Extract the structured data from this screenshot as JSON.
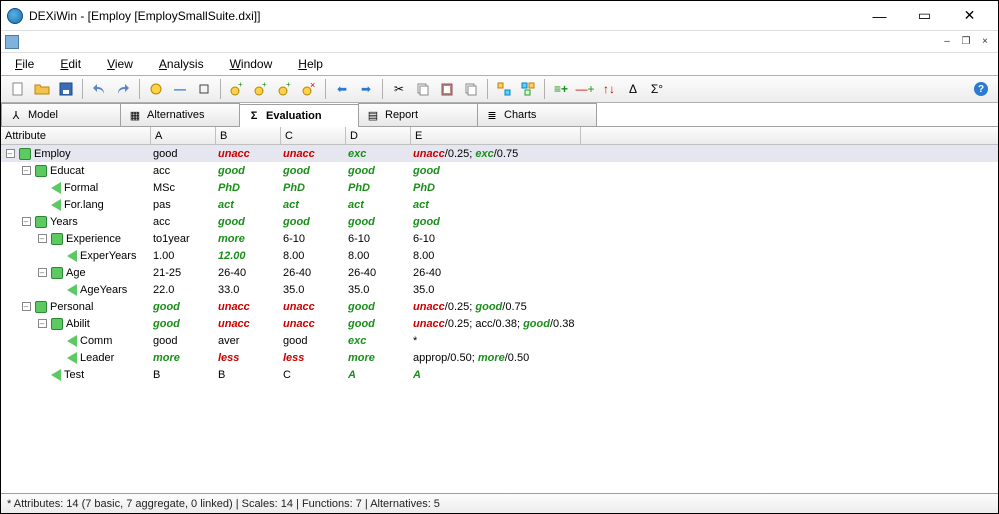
{
  "window": {
    "title": "DEXiWin - [Employ [EmploySmallSuite.dxi]]"
  },
  "menu": {
    "file": "File",
    "edit": "Edit",
    "view": "View",
    "analysis": "Analysis",
    "window": "Window",
    "help": "Help"
  },
  "tabs": {
    "model": "Model",
    "alternatives": "Alternatives",
    "evaluation": "Evaluation",
    "report": "Report",
    "charts": "Charts"
  },
  "grid": {
    "head_attr": "Attribute",
    "head_A": "A",
    "head_B": "B",
    "head_C": "C",
    "head_D": "D",
    "head_E": "E"
  },
  "rows": [
    {
      "name": "Employ",
      "level": 0,
      "kind": "agg",
      "sel": true,
      "A": {
        "t": "good",
        "cls": "v-mid"
      },
      "B": {
        "t": "unacc",
        "cls": "v-bad"
      },
      "C": {
        "t": "unacc",
        "cls": "v-bad"
      },
      "D": {
        "t": "exc",
        "cls": "v-exc"
      },
      "E": {
        "mix": [
          {
            "t": "unacc",
            "c": "red"
          },
          {
            "t": "/0.25; ",
            "c": "plain"
          },
          {
            "t": "exc",
            "c": "green"
          },
          {
            "t": "/0.75",
            "c": "plain"
          }
        ]
      }
    },
    {
      "name": "Educat",
      "level": 1,
      "kind": "agg",
      "A": {
        "t": "acc",
        "cls": "v-mid"
      },
      "B": {
        "t": "good",
        "cls": "v-good"
      },
      "C": {
        "t": "good",
        "cls": "v-good"
      },
      "D": {
        "t": "good",
        "cls": "v-good"
      },
      "E": {
        "t": "good",
        "cls": "v-good"
      }
    },
    {
      "name": "Formal",
      "level": 2,
      "kind": "basic",
      "A": {
        "t": "MSc",
        "cls": "v-mid"
      },
      "B": {
        "t": "PhD",
        "cls": "v-good"
      },
      "C": {
        "t": "PhD",
        "cls": "v-good"
      },
      "D": {
        "t": "PhD",
        "cls": "v-good"
      },
      "E": {
        "t": "PhD",
        "cls": "v-good"
      }
    },
    {
      "name": "For.lang",
      "level": 2,
      "kind": "basic",
      "A": {
        "t": "pas",
        "cls": "v-mid"
      },
      "B": {
        "t": "act",
        "cls": "v-good"
      },
      "C": {
        "t": "act",
        "cls": "v-good"
      },
      "D": {
        "t": "act",
        "cls": "v-good"
      },
      "E": {
        "t": "act",
        "cls": "v-good"
      }
    },
    {
      "name": "Years",
      "level": 1,
      "kind": "agg",
      "A": {
        "t": "acc",
        "cls": "v-mid"
      },
      "B": {
        "t": "good",
        "cls": "v-good"
      },
      "C": {
        "t": "good",
        "cls": "v-good"
      },
      "D": {
        "t": "good",
        "cls": "v-good"
      },
      "E": {
        "t": "good",
        "cls": "v-good"
      }
    },
    {
      "name": "Experience",
      "level": 2,
      "kind": "agg",
      "A": {
        "t": "to1year",
        "cls": "v-mid"
      },
      "B": {
        "t": "more",
        "cls": "v-good"
      },
      "C": {
        "t": "6-10",
        "cls": "v-mid"
      },
      "D": {
        "t": "6-10",
        "cls": "v-mid"
      },
      "E": {
        "t": "6-10",
        "cls": "v-mid"
      }
    },
    {
      "name": "ExperYears",
      "level": 3,
      "kind": "basic",
      "A": {
        "t": "1.00",
        "cls": "v-mid"
      },
      "B": {
        "t": "12.00",
        "cls": "v-good"
      },
      "C": {
        "t": "8.00",
        "cls": "v-mid"
      },
      "D": {
        "t": "8.00",
        "cls": "v-mid"
      },
      "E": {
        "t": "8.00",
        "cls": "v-mid"
      }
    },
    {
      "name": "Age",
      "level": 2,
      "kind": "agg",
      "A": {
        "t": "21-25",
        "cls": "v-mid"
      },
      "B": {
        "t": "26-40",
        "cls": "v-mid"
      },
      "C": {
        "t": "26-40",
        "cls": "v-mid"
      },
      "D": {
        "t": "26-40",
        "cls": "v-mid"
      },
      "E": {
        "t": "26-40",
        "cls": "v-mid"
      }
    },
    {
      "name": "AgeYears",
      "level": 3,
      "kind": "basic",
      "A": {
        "t": "22.0",
        "cls": "v-mid"
      },
      "B": {
        "t": "33.0",
        "cls": "v-mid"
      },
      "C": {
        "t": "35.0",
        "cls": "v-mid"
      },
      "D": {
        "t": "35.0",
        "cls": "v-mid"
      },
      "E": {
        "t": "35.0",
        "cls": "v-mid"
      }
    },
    {
      "name": "Personal",
      "level": 1,
      "kind": "agg",
      "A": {
        "t": "good",
        "cls": "v-good"
      },
      "B": {
        "t": "unacc",
        "cls": "v-bad"
      },
      "C": {
        "t": "unacc",
        "cls": "v-bad"
      },
      "D": {
        "t": "good",
        "cls": "v-good"
      },
      "E": {
        "mix": [
          {
            "t": "unacc",
            "c": "red"
          },
          {
            "t": "/0.25; ",
            "c": "plain"
          },
          {
            "t": "good",
            "c": "green"
          },
          {
            "t": "/0.75",
            "c": "plain"
          }
        ]
      }
    },
    {
      "name": "Abilit",
      "level": 2,
      "kind": "agg",
      "A": {
        "t": "good",
        "cls": "v-good"
      },
      "B": {
        "t": "unacc",
        "cls": "v-bad"
      },
      "C": {
        "t": "unacc",
        "cls": "v-bad"
      },
      "D": {
        "t": "good",
        "cls": "v-good"
      },
      "E": {
        "mix": [
          {
            "t": "unacc",
            "c": "red"
          },
          {
            "t": "/0.25; acc/0.38; ",
            "c": "plain"
          },
          {
            "t": "good",
            "c": "green"
          },
          {
            "t": "/0.38",
            "c": "plain"
          }
        ]
      }
    },
    {
      "name": "Comm",
      "level": 3,
      "kind": "basic",
      "A": {
        "t": "good",
        "cls": "v-mid"
      },
      "B": {
        "t": "aver",
        "cls": "v-mid"
      },
      "C": {
        "t": "good",
        "cls": "v-mid"
      },
      "D": {
        "t": "exc",
        "cls": "v-exc"
      },
      "E": {
        "t": "*",
        "cls": "v-mid"
      }
    },
    {
      "name": "Leader",
      "level": 3,
      "kind": "basic",
      "A": {
        "t": "more",
        "cls": "v-good"
      },
      "B": {
        "t": "less",
        "cls": "v-bad"
      },
      "C": {
        "t": "less",
        "cls": "v-bad"
      },
      "D": {
        "t": "more",
        "cls": "v-good"
      },
      "E": {
        "mix": [
          {
            "t": "approp/0.50; ",
            "c": "plain"
          },
          {
            "t": "more",
            "c": "green"
          },
          {
            "t": "/0.50",
            "c": "plain"
          }
        ]
      }
    },
    {
      "name": "Test",
      "level": 2,
      "kind": "basic",
      "A": {
        "t": "B",
        "cls": "v-mid"
      },
      "B": {
        "t": "B",
        "cls": "v-mid"
      },
      "C": {
        "t": "C",
        "cls": "v-mid"
      },
      "D": {
        "t": "A",
        "cls": "v-good"
      },
      "E": {
        "t": "A",
        "cls": "v-good"
      }
    }
  ],
  "status": "* Attributes: 14 (7 basic, 7 aggregate, 0 linked)  |  Scales: 14  |  Functions: 7  |  Alternatives: 5"
}
